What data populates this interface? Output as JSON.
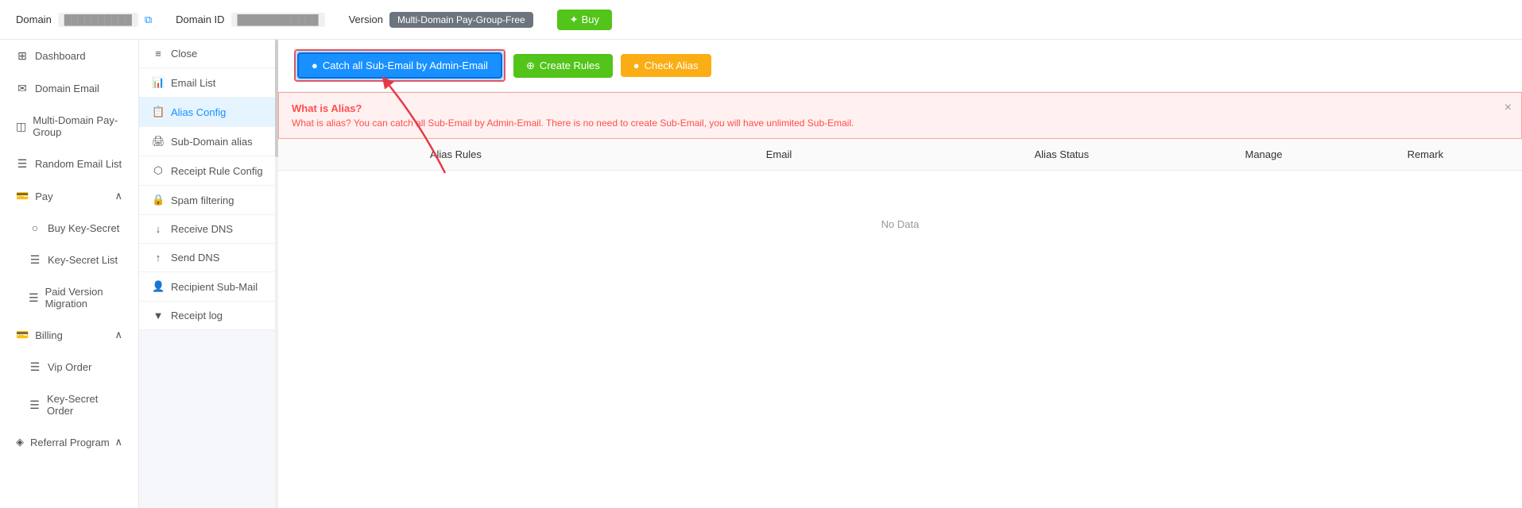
{
  "header": {
    "domain_label": "Domain",
    "domain_id_label": "Domain ID",
    "version_label": "Version",
    "version_value": "Multi-Domain Pay-Group-Free",
    "buy_label": "Buy",
    "domain_placeholder": "██████████",
    "domain_id_placeholder": "████████████"
  },
  "left_sidebar": {
    "items": [
      {
        "id": "dashboard",
        "label": "Dashboard",
        "icon": "⊞"
      },
      {
        "id": "domain-email",
        "label": "Domain Email",
        "icon": "✉"
      },
      {
        "id": "multi-domain",
        "label": "Multi-Domain Pay-Group",
        "icon": "◫"
      },
      {
        "id": "random-email",
        "label": "Random Email List",
        "icon": "☰"
      },
      {
        "id": "pay",
        "label": "Pay",
        "icon": "💳",
        "expandable": true,
        "expanded": true
      },
      {
        "id": "buy-key",
        "label": "Buy Key-Secret",
        "icon": "○",
        "sub": true
      },
      {
        "id": "key-secret-list",
        "label": "Key-Secret List",
        "icon": "☰",
        "sub": true
      },
      {
        "id": "paid-version",
        "label": "Paid Version Migration",
        "icon": "☰",
        "sub": true
      },
      {
        "id": "billing",
        "label": "Billing",
        "icon": "💳",
        "expandable": true,
        "expanded": true
      },
      {
        "id": "vip-order",
        "label": "Vip Order",
        "icon": "☰",
        "sub": true
      },
      {
        "id": "key-secret-order",
        "label": "Key-Secret Order",
        "icon": "☰",
        "sub": true
      },
      {
        "id": "referral",
        "label": "Referral Program",
        "icon": "◈",
        "expandable": true
      }
    ]
  },
  "sub_sidebar": {
    "items": [
      {
        "id": "close",
        "label": "Close",
        "icon": "≡"
      },
      {
        "id": "email-list",
        "label": "Email List",
        "icon": "📊"
      },
      {
        "id": "alias-config",
        "label": "Alias Config",
        "icon": "📋",
        "active": true
      },
      {
        "id": "sub-domain-alias",
        "label": "Sub-Domain alias",
        "icon": "🖨"
      },
      {
        "id": "receipt-rule-config",
        "label": "Receipt Rule Config",
        "icon": "⬡"
      },
      {
        "id": "spam-filtering",
        "label": "Spam filtering",
        "icon": "🔒"
      },
      {
        "id": "receive-dns",
        "label": "Receive DNS",
        "icon": "↓"
      },
      {
        "id": "send-dns",
        "label": "Send DNS",
        "icon": "↑"
      },
      {
        "id": "recipient-sub-mail",
        "label": "Recipient Sub-Mail",
        "icon": "👤"
      },
      {
        "id": "receipt-log",
        "label": "Receipt log",
        "icon": "▼"
      }
    ]
  },
  "action_bar": {
    "catch_all_label": "Catch all Sub-Email by Admin-Email",
    "create_rules_label": "Create Rules",
    "check_alias_label": "Check Alias",
    "catch_all_icon": "●",
    "create_rules_icon": "⊕",
    "check_alias_icon": "●"
  },
  "info_box": {
    "title": "What is Alias?",
    "text": "What is alias? You can catch all Sub-Email by Admin-Email. There is no need to create Sub-Email, you will have unlimited Sub-Email."
  },
  "table": {
    "headers": [
      "Alias Rules",
      "Email",
      "Alias Status",
      "Manage",
      "Remark"
    ],
    "empty_text": "No Data"
  }
}
